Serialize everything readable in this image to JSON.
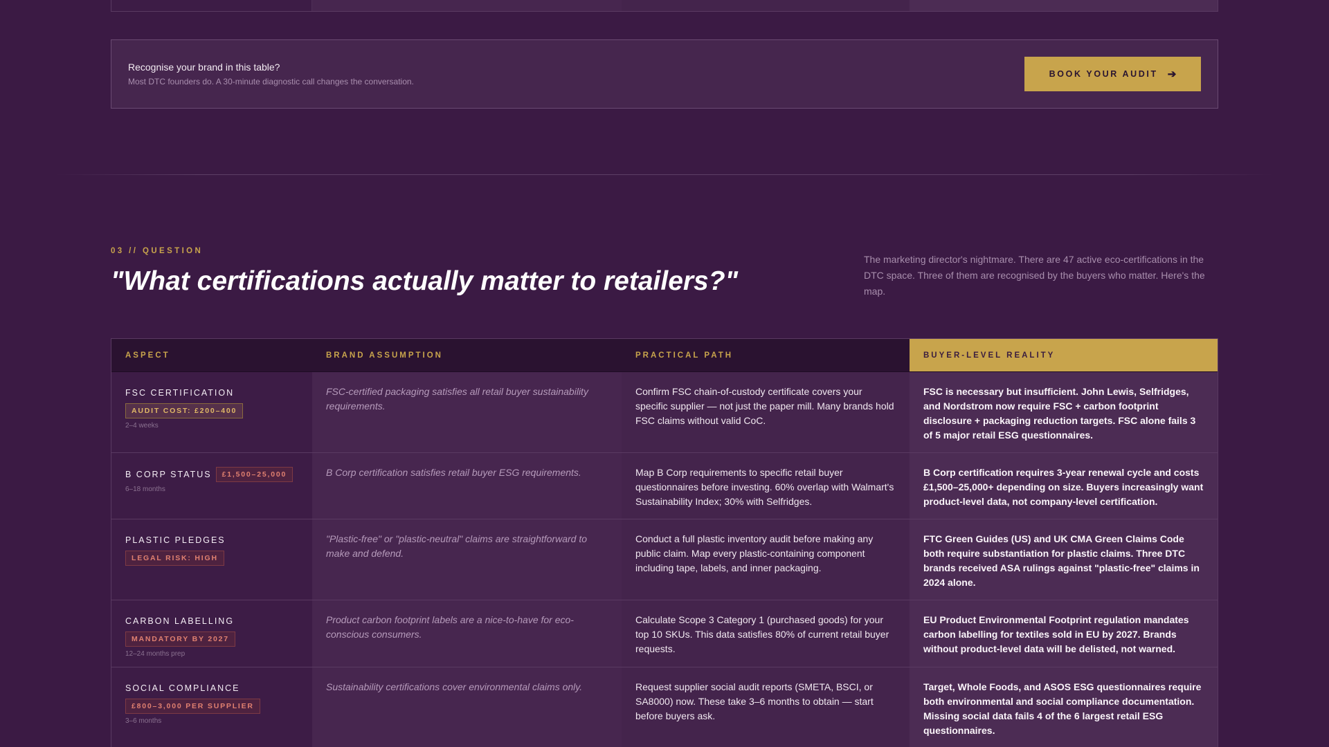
{
  "cta": {
    "title": "Recognise your brand in this table?",
    "subtitle": "Most DTC founders do. A 30-minute diagnostic call changes the conversation.",
    "button_label": "BOOK YOUR AUDIT",
    "button_icon": "arrow-right-icon"
  },
  "question": {
    "eyebrow": "03 // QUESTION",
    "title": "\"What certifications actually matter to retailers?\"",
    "description": "The marketing director's nightmare. There are 47 active eco-certifications in the DTC space. Three of them are recognised by the buyers who matter. Here's the map."
  },
  "table": {
    "headers": [
      "ASPECT",
      "BRAND ASSUMPTION",
      "PRACTICAL PATH",
      "BUYER-LEVEL REALITY"
    ],
    "rows": [
      {
        "aspect": "FSC CERTIFICATION",
        "badge": "AUDIT COST: £200–400",
        "timing": "2–4 weeks",
        "assumption": "FSC-certified packaging satisfies all retail buyer sustainability requirements.",
        "path": "Confirm FSC chain-of-custody certificate covers your specific supplier — not just the paper mill. Many brands hold FSC claims without valid CoC.",
        "reality": "FSC is necessary but insufficient. John Lewis, Selfridges, and Nordstrom now require FSC + carbon footprint disclosure + packaging reduction targets. FSC alone fails 3 of 5 major retail ESG questionnaires."
      },
      {
        "aspect": "B CORP STATUS",
        "badge": "£1,500–25,000",
        "timing": "6–18 months",
        "assumption": "B Corp certification satisfies retail buyer ESG requirements.",
        "path": "Map B Corp requirements to specific retail buyer questionnaires before investing. 60% overlap with Walmart's Sustainability Index; 30% with Selfridges.",
        "reality": "B Corp certification requires 3-year renewal cycle and costs £1,500–25,000+ depending on size. Buyers increasingly want product-level data, not company-level certification."
      },
      {
        "aspect": "PLASTIC PLEDGES",
        "badge": "LEGAL RISK: HIGH",
        "timing": "",
        "assumption": "\"Plastic-free\" or \"plastic-neutral\" claims are straightforward to make and defend.",
        "path": "Conduct a full plastic inventory audit before making any public claim. Map every plastic-containing component including tape, labels, and inner packaging.",
        "reality": "FTC Green Guides (US) and UK CMA Green Claims Code both require substantiation for plastic claims. Three DTC brands received ASA rulings against \"plastic-free\" claims in 2024 alone."
      },
      {
        "aspect": "CARBON LABELLING",
        "badge": "MANDATORY BY 2027",
        "timing": "12–24 months prep",
        "assumption": "Product carbon footprint labels are a nice-to-have for eco-conscious consumers.",
        "path": "Calculate Scope 3 Category 1 (purchased goods) for your top 10 SKUs. This data satisfies 80% of current retail buyer requests.",
        "reality": "EU Product Environmental Footprint regulation mandates carbon labelling for textiles sold in EU by 2027. Brands without product-level data will be delisted, not warned."
      },
      {
        "aspect": "SOCIAL COMPLIANCE",
        "badge": "£800–3,000 PER SUPPLIER",
        "timing": "3–6 months",
        "assumption": "Sustainability certifications cover environmental claims only.",
        "path": "Request supplier social audit reports (SMETA, BSCI, or SA8000) now. These take 3–6 months to obtain — start before buyers ask.",
        "reality": "Target, Whole Foods, and ASOS ESG questionnaires require both environmental and social compliance documentation. Missing social data fails 4 of the 6 largest retail ESG questionnaires."
      }
    ]
  }
}
